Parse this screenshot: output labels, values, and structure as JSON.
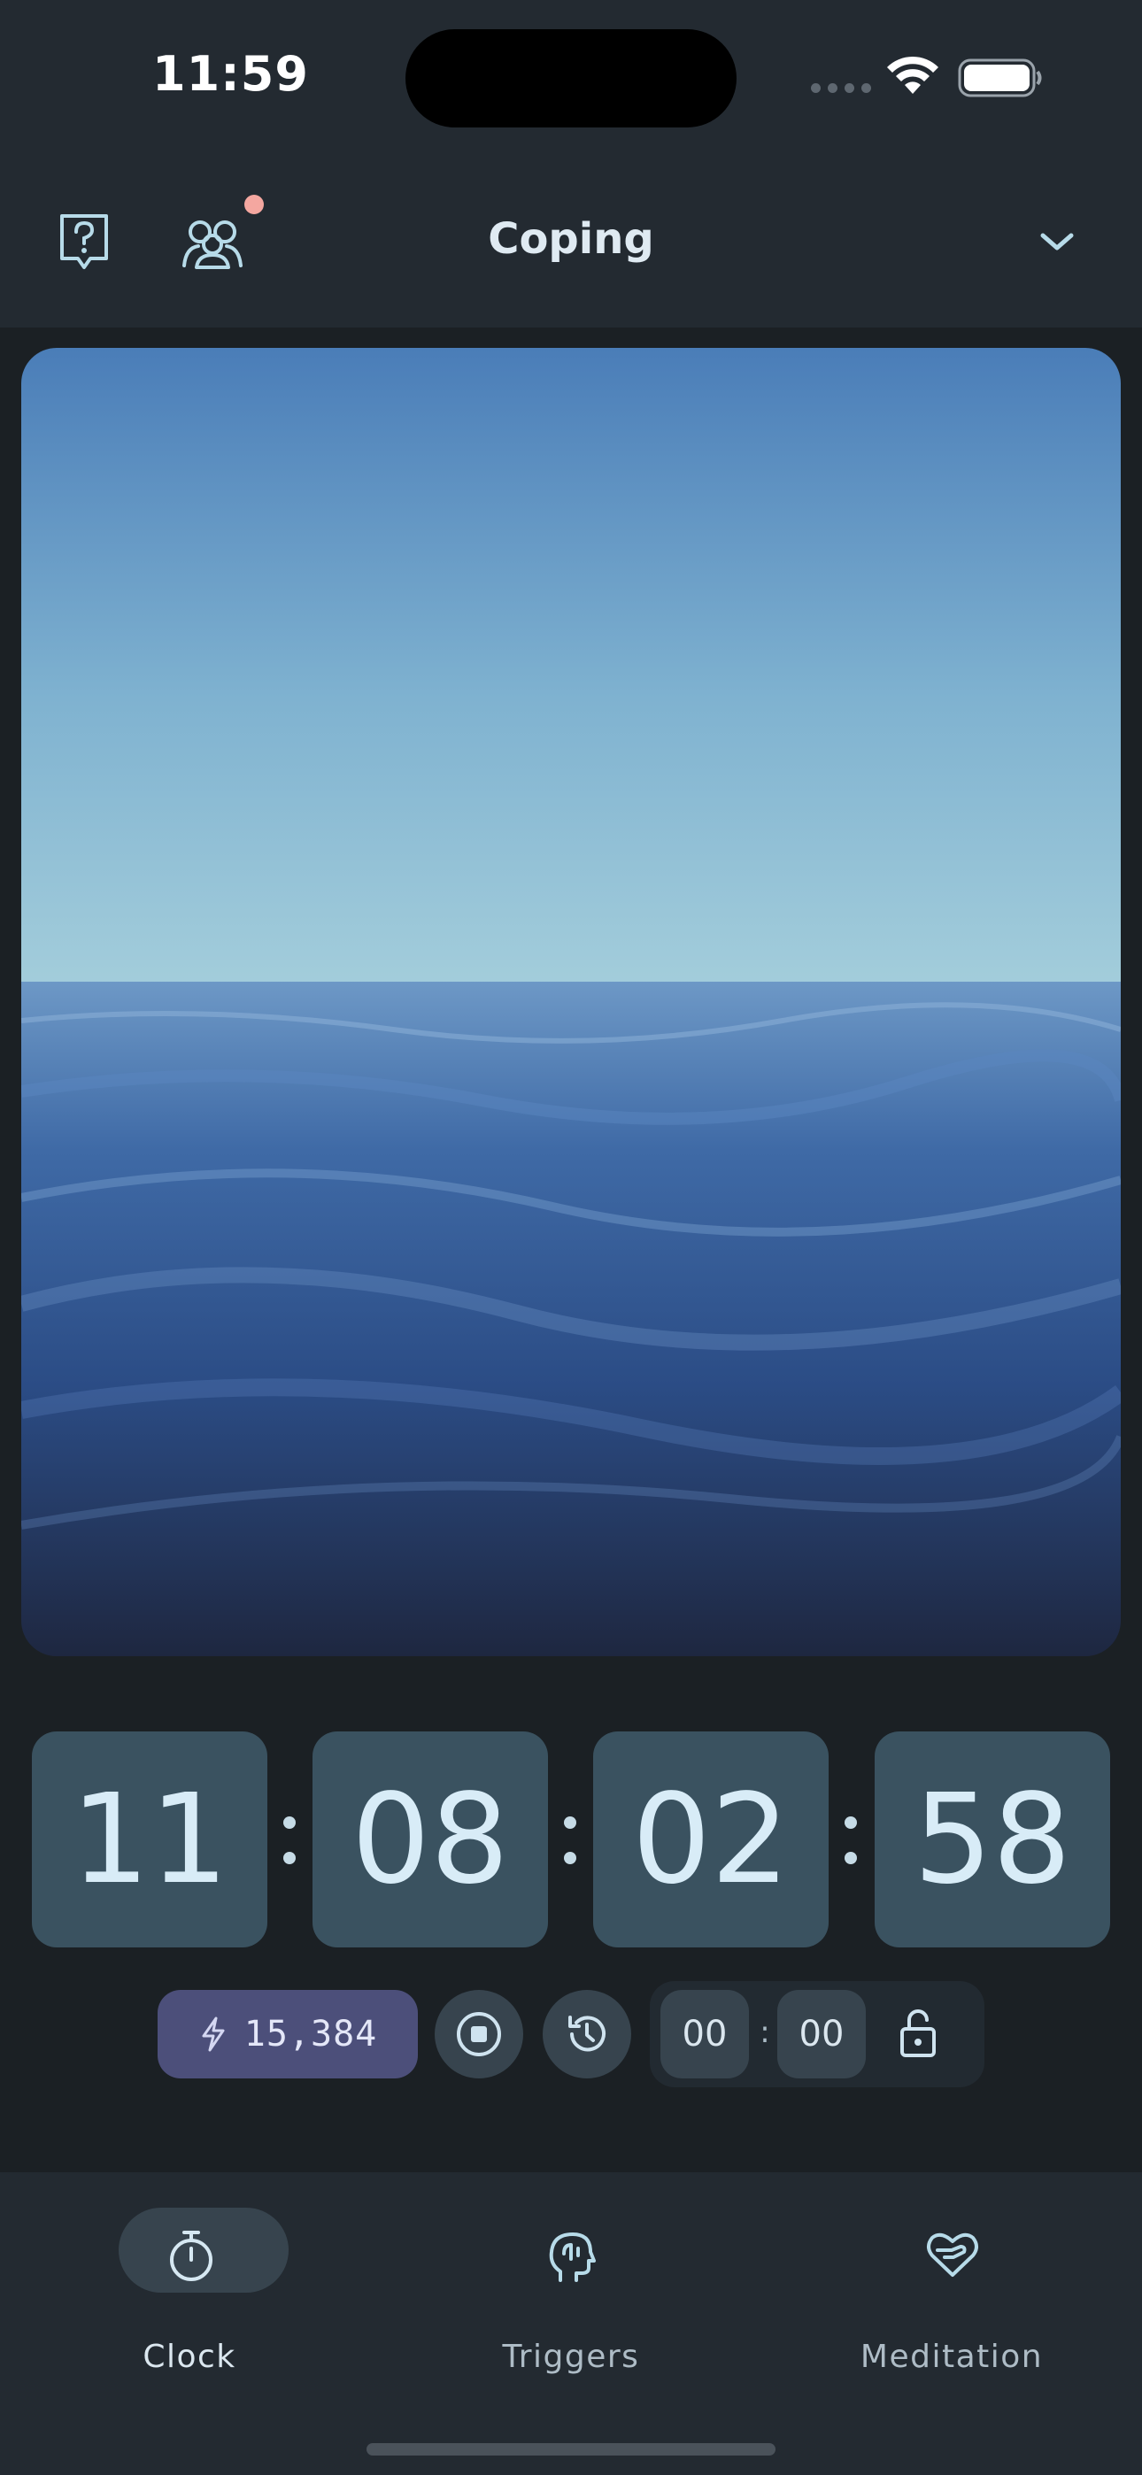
{
  "status_bar": {
    "time": "11:59",
    "icons": [
      "cellular-signal-icon",
      "wifi-icon",
      "battery-icon"
    ]
  },
  "header": {
    "title": "Coping",
    "icons": [
      "help-icon",
      "friends-icon",
      "chevron-down-icon"
    ],
    "notification_dot_color": "#f4a7a0"
  },
  "hero_image": {
    "subject": "ocean-horizon-photo",
    "colors": {
      "sky_top": "#4a7db8",
      "sky_horizon": "#9ac6d8",
      "water_dark": "#1f2d4a"
    }
  },
  "clock": {
    "segments": [
      "11",
      "08",
      "02",
      "58"
    ]
  },
  "controls": {
    "energy_value": "15,384",
    "energy_icon": "lightning-icon",
    "stop_icon": "stop-circle-icon",
    "history_icon": "history-icon",
    "timer_minutes": "00",
    "timer_separator": ":",
    "timer_seconds": "00",
    "lock_icon": "unlock-icon"
  },
  "bottom_nav": {
    "items": [
      {
        "label": "Clock",
        "icon": "stopwatch-icon",
        "active": true
      },
      {
        "label": "Triggers",
        "icon": "head-brain-icon",
        "active": false
      },
      {
        "label": "Meditation",
        "icon": "heart-hand-icon",
        "active": false
      }
    ]
  },
  "colors": {
    "background": "#1b2024",
    "surface": "#232a31",
    "digit_box": "#3a5260",
    "button": "#37444e",
    "energy_pill": "#4c4f7a",
    "text": "#dbe7ef"
  }
}
